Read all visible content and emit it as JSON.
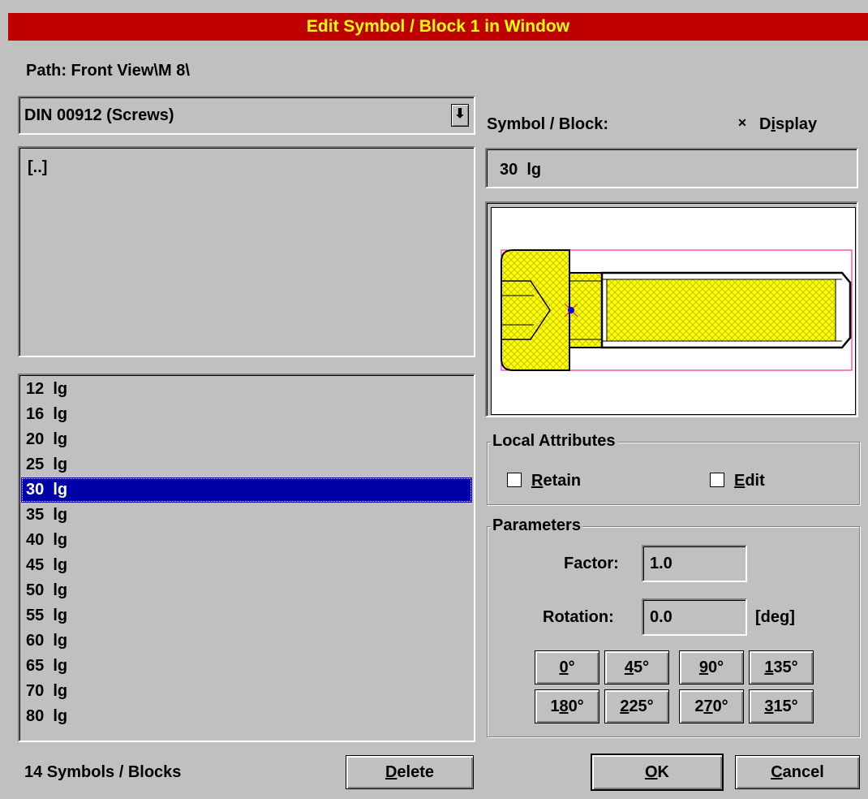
{
  "title": "Edit Symbol / Block 1 in Window",
  "path_label": "Path: Front View\\M  8\\",
  "library_select": {
    "value": "DIN 00912 (Screws)"
  },
  "folder_list": [
    "[..]"
  ],
  "symbol_list": {
    "items": [
      "12  lg",
      "16  lg",
      "20  lg",
      "25  lg",
      "30  lg",
      "35  lg",
      "40  lg",
      "45  lg",
      "50  lg",
      "55  lg",
      "60  lg",
      "65  lg",
      "70  lg",
      "80  lg"
    ],
    "selected": "30  lg"
  },
  "count_label": "14 Symbols / Blocks",
  "delete_button": {
    "pre": "",
    "u": "D",
    "post": "elete"
  },
  "symbol_block_label": "Symbol / Block:",
  "display_checkbox": {
    "pre": "",
    "u": "i",
    "label_start": "D",
    "post": "splay",
    "checked": true,
    "mark": "✕"
  },
  "symbol_name": "30  lg",
  "local_attributes": {
    "title": "Local Attributes",
    "retain": {
      "u": "R",
      "post": "etain",
      "checked": false
    },
    "edit": {
      "u": "E",
      "post": "dit",
      "checked": false
    }
  },
  "parameters": {
    "title": "Parameters",
    "factor_label": "Factor:",
    "factor_value": "1.0",
    "rotation_label": "Rotation:",
    "rotation_value": "0.0",
    "rotation_unit": "[deg]",
    "angles": [
      {
        "u": "0",
        "rest": "°"
      },
      {
        "u": "4",
        "rest": "5°"
      },
      {
        "u": "9",
        "rest": "0°"
      },
      {
        "u": "1",
        "rest": "35°"
      },
      {
        "u": "1",
        "rest": "80°",
        "u2": "8",
        "pre": "1"
      },
      {
        "u": "2",
        "rest": "25°"
      },
      {
        "u": "2",
        "rest": "70°",
        "pre": "2",
        "u2": "7"
      },
      {
        "u": "3",
        "rest": "15°"
      }
    ]
  },
  "ok_button": {
    "u": "O",
    "post": "K"
  },
  "cancel_button": {
    "u": "C",
    "post": "ancel"
  },
  "colors": {
    "title_bg": "#c00000",
    "title_fg": "#ffff00",
    "selection": "#0000a8",
    "hatch": "#ffff00",
    "bbox": "#ff0080"
  }
}
